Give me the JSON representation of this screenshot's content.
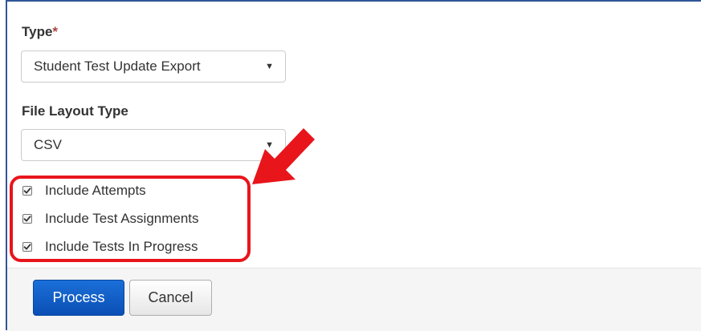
{
  "form": {
    "type_label": "Type",
    "required_marker": "*",
    "type_select": {
      "value": "Student Test Update Export",
      "arrow": "▼"
    },
    "layout_label": "File Layout Type",
    "layout_select": {
      "value": "CSV",
      "arrow": "▼"
    },
    "checkboxes": [
      {
        "label": "Include Attempts",
        "checked": true
      },
      {
        "label": "Include Test Assignments",
        "checked": true
      },
      {
        "label": "Include Tests In Progress",
        "checked": true
      }
    ]
  },
  "footer": {
    "process_label": "Process",
    "cancel_label": "Cancel"
  },
  "annotation": {
    "highlight_color": "#e8151b"
  },
  "colors": {
    "primary": "#1a6fd8",
    "required": "#a94442"
  }
}
